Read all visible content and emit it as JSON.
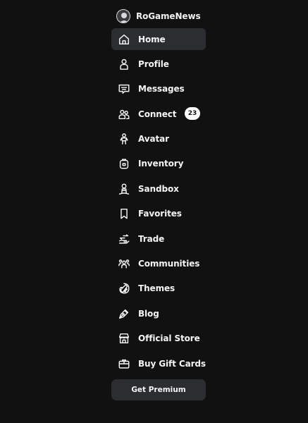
{
  "header": {
    "username": "RoGameNews"
  },
  "nav": {
    "items": [
      {
        "label": "Home",
        "icon": "home-icon"
      },
      {
        "label": "Profile",
        "icon": "profile-icon"
      },
      {
        "label": "Messages",
        "icon": "messages-icon"
      },
      {
        "label": "Connect",
        "icon": "connect-icon",
        "badge": "23"
      },
      {
        "label": "Avatar",
        "icon": "avatar-icon"
      },
      {
        "label": "Inventory",
        "icon": "inventory-icon"
      },
      {
        "label": "Sandbox",
        "icon": "sandbox-icon"
      },
      {
        "label": "Favorites",
        "icon": "favorites-icon"
      },
      {
        "label": "Trade",
        "icon": "trade-icon"
      },
      {
        "label": "Communities",
        "icon": "communities-icon"
      },
      {
        "label": "Themes",
        "icon": "themes-icon"
      },
      {
        "label": "Blog",
        "icon": "blog-icon"
      },
      {
        "label": "Official Store",
        "icon": "store-icon"
      },
      {
        "label": "Buy Gift Cards",
        "icon": "gift-card-icon"
      }
    ],
    "active": "Home"
  },
  "premium_button": {
    "label": "Get Premium"
  },
  "colors": {
    "background": "#111112",
    "active_item": "#2b2d31",
    "text": "#f5f5f5",
    "badge_bg": "#ffffff"
  }
}
